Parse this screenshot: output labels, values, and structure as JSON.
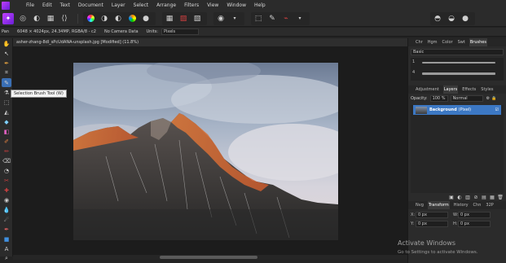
{
  "menu": {
    "items": [
      "File",
      "Edit",
      "Text",
      "Document",
      "Layer",
      "Select",
      "Arrange",
      "Filters",
      "View",
      "Window",
      "Help"
    ]
  },
  "toolbar": {
    "personas": [
      "photo-persona-icon",
      "liquify-persona-icon",
      "develop-persona-icon",
      "tone-mapping-persona-icon",
      "export-persona-icon"
    ]
  },
  "context": {
    "tool": "Pan",
    "doc_info": "6048 × 4024px, 24.34MP, RGBA/8 - c2",
    "camera": "No Camera Data",
    "units_label": "Units:",
    "units_value": "Pixels"
  },
  "document": {
    "tab_title": "asher-zhang-8dl_sPcUdANA-unsplash.jpg [Modified] (11.8%)"
  },
  "tooltip": {
    "text": "Selection Brush Tool (W)"
  },
  "panels": {
    "top_tabs": [
      "Chr",
      "Hgm",
      "Color",
      "Swt",
      "Brushes"
    ],
    "top_active": "Brushes",
    "brush_category": "Basic",
    "brush_numbers": [
      "1",
      "4"
    ],
    "mid_tabs": [
      "Adjustment",
      "Layers",
      "Effects",
      "Styles"
    ],
    "mid_active": "Layers",
    "opacity_label": "Opacity:",
    "opacity_value": "100 %",
    "blend_mode": "Normal",
    "layer_name": "Background",
    "layer_type": "(Pixel)",
    "bottom_tabs": [
      "Nvg",
      "Transform",
      "History",
      "Chn",
      "32P"
    ],
    "bottom_active": "Transform",
    "transform": {
      "x_label": "X:",
      "x_value": "0 px",
      "y_label": "Y:",
      "y_value": "0 px",
      "w_label": "W:",
      "w_value": "0 px",
      "h_label": "H:",
      "h_value": "0 px"
    }
  },
  "watermark": {
    "title": "Activate Windows",
    "sub": "Go to Settings to activate Windows."
  },
  "colors": {
    "accent": "#3c78c4",
    "persona_purple": "#b13cf5"
  }
}
